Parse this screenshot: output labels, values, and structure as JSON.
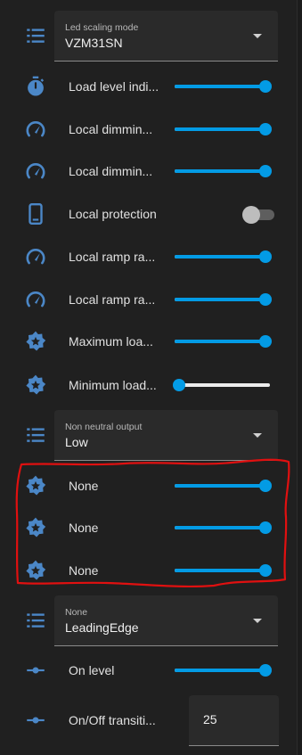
{
  "colors": {
    "accent": "#039be5",
    "icon": "#4b87c7",
    "annotation": "#e01010"
  },
  "rows": [
    {
      "kind": "select",
      "icon": "list-icon",
      "select_label": "Led scaling mode",
      "select_value": "VZM31SN"
    },
    {
      "kind": "slider",
      "icon": "timer-icon",
      "label": "Load level indi...",
      "value": 100
    },
    {
      "kind": "slider",
      "icon": "speedometer-icon",
      "label": "Local dimmin...",
      "value": 100
    },
    {
      "kind": "slider",
      "icon": "speedometer-icon",
      "label": "Local dimmin...",
      "value": 100
    },
    {
      "kind": "toggle",
      "icon": "phone-icon",
      "label": "Local protection",
      "on": false
    },
    {
      "kind": "slider",
      "icon": "speedometer-icon",
      "label": "Local ramp ra...",
      "value": 100
    },
    {
      "kind": "slider",
      "icon": "speedometer-icon",
      "label": "Local ramp ra...",
      "value": 100
    },
    {
      "kind": "slider",
      "icon": "gear-star-icon",
      "label": "Maximum loa...",
      "value": 100
    },
    {
      "kind": "slider",
      "icon": "gear-star-icon",
      "label": "Minimum load...",
      "value": 0
    },
    {
      "kind": "select",
      "icon": "list-icon",
      "select_label": "Non neutral output",
      "select_value": "Low"
    },
    {
      "kind": "slider",
      "icon": "gear-star-icon",
      "label": "None",
      "value": 100
    },
    {
      "kind": "slider",
      "icon": "gear-star-icon",
      "label": "None",
      "value": 100
    },
    {
      "kind": "slider",
      "icon": "gear-star-icon",
      "label": "None",
      "value": 100
    },
    {
      "kind": "select",
      "icon": "list-icon",
      "select_label": "None",
      "select_value": "LeadingEdge"
    },
    {
      "kind": "slider",
      "icon": "slider-icon",
      "label": "On level",
      "value": 100
    },
    {
      "kind": "number",
      "icon": "slider-icon",
      "label": "On/Off transiti...",
      "value": "25"
    }
  ]
}
